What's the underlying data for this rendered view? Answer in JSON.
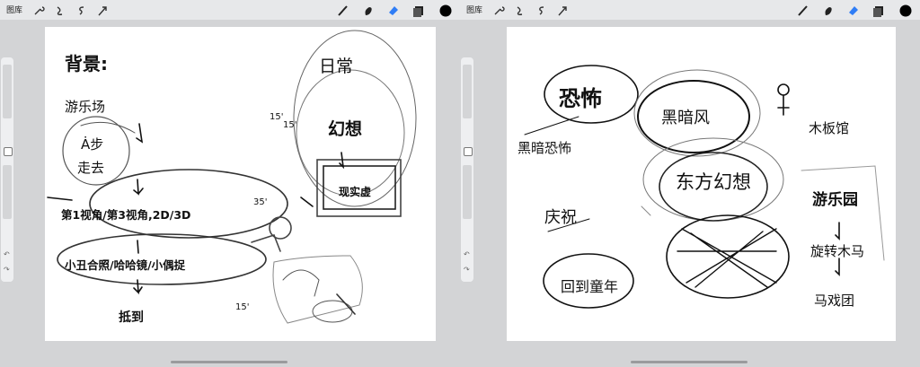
{
  "left": {
    "toolbar": {
      "gallery": "图库"
    },
    "sketch": {
      "heading": "背景:",
      "amusement": "游乐场",
      "run": "Ȧ步",
      "go": "走去",
      "transition": "第1视角/第3视角,2D/3D",
      "photo": "小丑合照/哈哈镜/小偶捉",
      "arrive": "抵到",
      "daily": "日常",
      "fantasy": "幻想",
      "reality": "现实虚",
      "angle1": "15'",
      "angle2": "15'",
      "angle3": "35'",
      "angle4": "15'"
    }
  },
  "right": {
    "toolbar": {
      "gallery": "图库"
    },
    "sketch": {
      "big": "恐怖",
      "dark": "黑暗风",
      "dark_trend": "黑暗恐怖",
      "oriental": "东方幻想",
      "wood": "木板馆",
      "celebrate": "庆祝",
      "childhood": "回到童年",
      "amuse": "游乐园",
      "carousel": "旋转木马",
      "house": "马戏团"
    }
  }
}
